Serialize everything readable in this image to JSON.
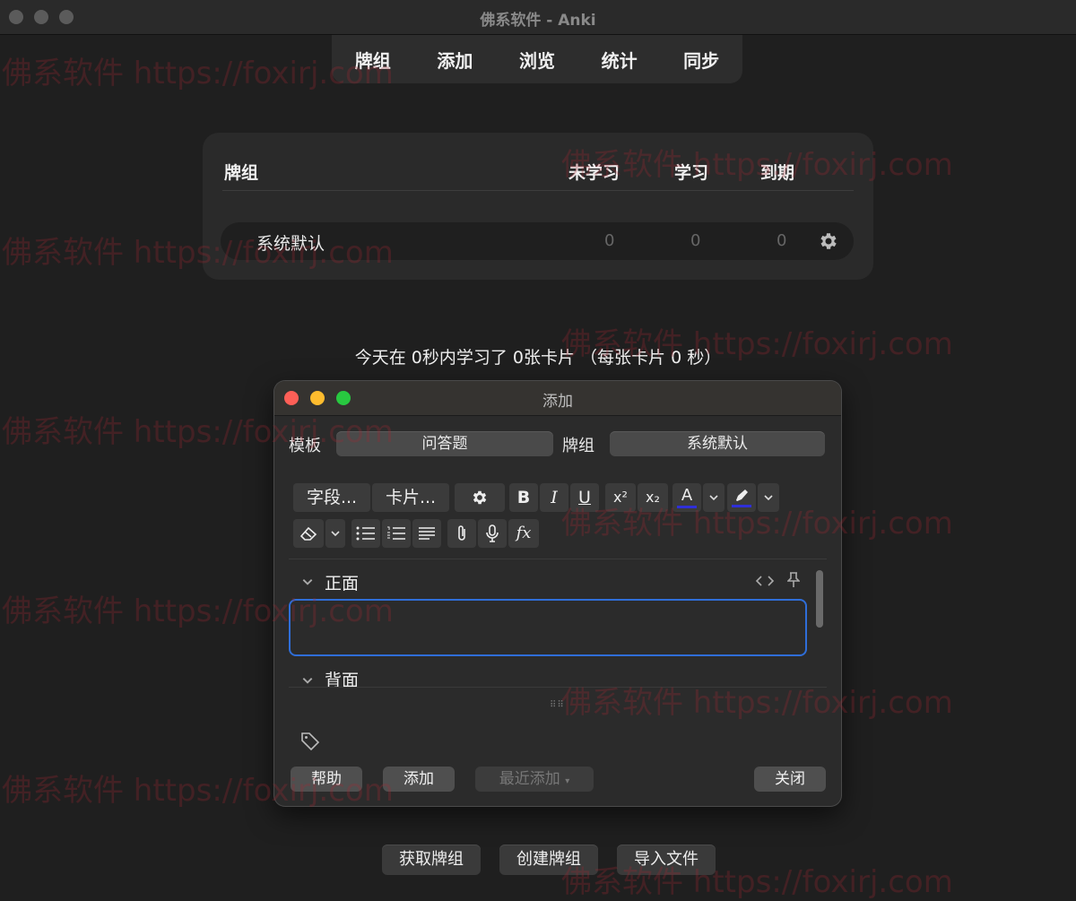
{
  "window": {
    "title": "佛系软件 - Anki"
  },
  "nav": {
    "items": [
      "牌组",
      "添加",
      "浏览",
      "统计",
      "同步"
    ]
  },
  "deck_table": {
    "headers": {
      "deck": "牌组",
      "new": "未学习",
      "learn": "学习",
      "due": "到期"
    },
    "rows": [
      {
        "name": "系统默认",
        "new": "0",
        "learn": "0",
        "due": "0"
      }
    ]
  },
  "study_info": "今天在 0秒内学习了 0张卡片 （每张卡片 0 秒）",
  "dialog": {
    "title": "添加",
    "type_label": "模板",
    "type_value": "问答题",
    "deck_label": "牌组",
    "deck_value": "系统默认",
    "toolbar": {
      "fields_label": "字段...",
      "cards_label": "卡片...",
      "bold": "B",
      "italic": "I",
      "underline": "U",
      "sup": "x²",
      "sub": "x₂",
      "color": "A",
      "fx": "fx"
    },
    "fields": [
      {
        "label": "正面"
      },
      {
        "label": "背面"
      }
    ],
    "buttons": {
      "help": "帮助",
      "add": "添加",
      "history": "最近添加",
      "close": "关闭"
    }
  },
  "bottom_buttons": {
    "get_shared": "获取牌组",
    "create": "创建牌组",
    "import": "导入文件"
  },
  "watermark": "佛系软件 https://foxirj.com",
  "colors": {
    "accent_blue": "#2f6ed8",
    "traffic_red": "#fe5f57",
    "traffic_yellow": "#febc2e",
    "traffic_green": "#28c840"
  }
}
